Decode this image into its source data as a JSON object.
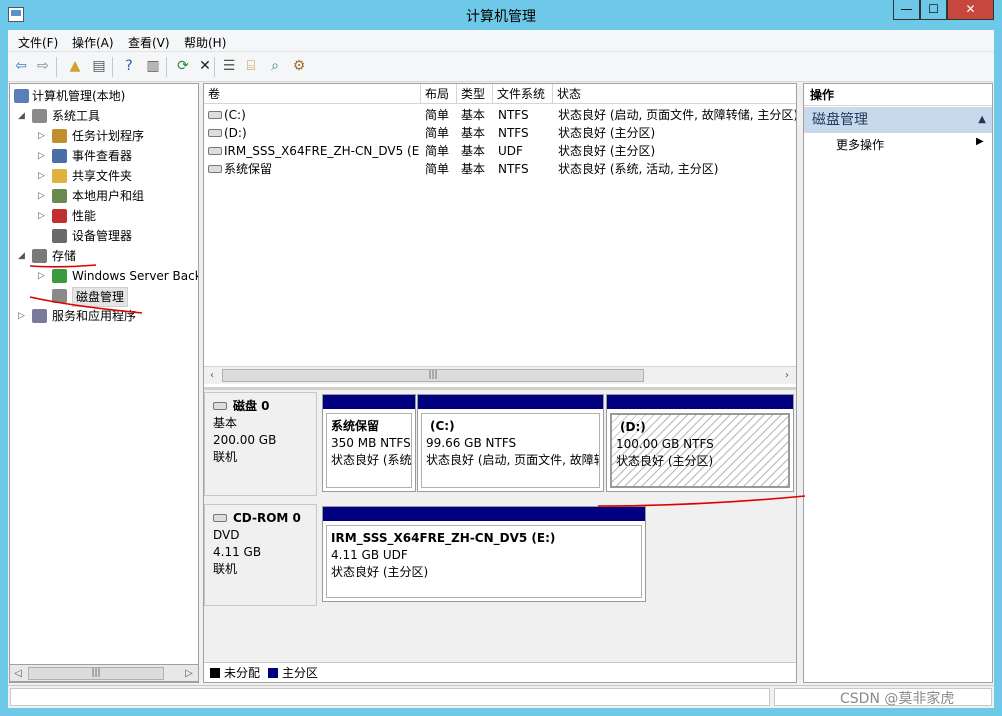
{
  "window": {
    "title": "计算机管理",
    "min": "—",
    "max": "☐",
    "close": "✕"
  },
  "menu": [
    "文件(F)",
    "操作(A)",
    "查看(V)",
    "帮助(H)"
  ],
  "toolbar": [
    {
      "name": "back-arrow-icon",
      "glyph": "⇦"
    },
    {
      "name": "forward-arrow-icon",
      "glyph": "⇨"
    },
    {
      "name": "up-folder-icon",
      "glyph": "▲"
    },
    {
      "name": "show-hide-tree-icon",
      "glyph": "▤"
    },
    {
      "name": "help-icon",
      "glyph": "?"
    },
    {
      "name": "show-hide-action-pane-icon",
      "glyph": "▥"
    },
    {
      "name": "refresh-icon",
      "glyph": "⟳"
    },
    {
      "name": "delete-icon",
      "glyph": "✕"
    },
    {
      "name": "properties-icon",
      "glyph": "☰"
    },
    {
      "name": "open-folder-icon",
      "glyph": "⌸"
    },
    {
      "name": "search-disk-icon",
      "glyph": "⌕"
    },
    {
      "name": "wizard-icon",
      "glyph": "⚙"
    }
  ],
  "tree": [
    {
      "label": "计算机管理(本地)",
      "icon": "computer-icon",
      "color": "#5a7fb8"
    },
    {
      "label": "系统工具",
      "icon": "tools-icon",
      "color": "#8a8a8a"
    },
    {
      "label": "任务计划程序",
      "icon": "clock-icon",
      "color": "#c09030"
    },
    {
      "label": "事件查看器",
      "icon": "event-viewer-icon",
      "color": "#4a6fa8"
    },
    {
      "label": "共享文件夹",
      "icon": "shared-folder-icon",
      "color": "#e0b040"
    },
    {
      "label": "本地用户和组",
      "icon": "users-icon",
      "color": "#6a8a50"
    },
    {
      "label": "性能",
      "icon": "performance-icon",
      "color": "#c03030"
    },
    {
      "label": "设备管理器",
      "icon": "device-manager-icon",
      "color": "#6a6a6a"
    },
    {
      "label": "存储",
      "icon": "storage-icon",
      "color": "#7a7a7a"
    },
    {
      "label": "Windows Server Back",
      "icon": "backup-icon",
      "color": "#3a9a40"
    },
    {
      "label": "磁盘管理",
      "icon": "disk-management-icon",
      "color": "#8a8a8a"
    },
    {
      "label": "服务和应用程序",
      "icon": "services-icon",
      "color": "#7a7a9a"
    }
  ],
  "volume_list": {
    "headers": [
      "卷",
      "布局",
      "类型",
      "文件系统",
      "状态"
    ],
    "rows": [
      {
        "name": "(C:)",
        "layout": "简单",
        "type": "基本",
        "fs": "NTFS",
        "status": "状态良好 (启动, 页面文件, 故障转储, 主分区)"
      },
      {
        "name": "(D:)",
        "layout": "简单",
        "type": "基本",
        "fs": "NTFS",
        "status": "状态良好 (主分区)"
      },
      {
        "name": "IRM_SSS_X64FRE_ZH-CN_DV5 (E:)",
        "layout": "简单",
        "type": "基本",
        "fs": "UDF",
        "status": "状态良好 (主分区)"
      },
      {
        "name": "系统保留",
        "layout": "简单",
        "type": "基本",
        "fs": "NTFS",
        "status": "状态良好 (系统, 活动, 主分区)"
      }
    ]
  },
  "disks": [
    {
      "title": "磁盘 0",
      "kind": "基本",
      "size": "200.00 GB",
      "state": "联机",
      "partitions": [
        {
          "name": "系统保留",
          "size": "350 MB NTFS",
          "status": "状态良好 (系统"
        },
        {
          "name": "(C:)",
          "size": "99.66 GB NTFS",
          "status": "状态良好 (启动, 页面文件, 故障转"
        },
        {
          "name": "(D:)",
          "size": "100.00 GB NTFS",
          "status": "状态良好 (主分区)"
        }
      ]
    },
    {
      "title": "CD-ROM 0",
      "kind": "DVD",
      "size": "4.11 GB",
      "state": "联机",
      "partitions": [
        {
          "name": "IRM_SSS_X64FRE_ZH-CN_DV5  (E:)",
          "size": "4.11 GB UDF",
          "status": "状态良好 (主分区)"
        }
      ]
    }
  ],
  "legend": [
    {
      "label": "未分配",
      "color": "#000000"
    },
    {
      "label": "主分区",
      "color": "#000080"
    }
  ],
  "actions": {
    "header": "操作",
    "section": "磁盘管理",
    "item": "更多操作"
  },
  "watermark": "CSDN @莫非家虎"
}
